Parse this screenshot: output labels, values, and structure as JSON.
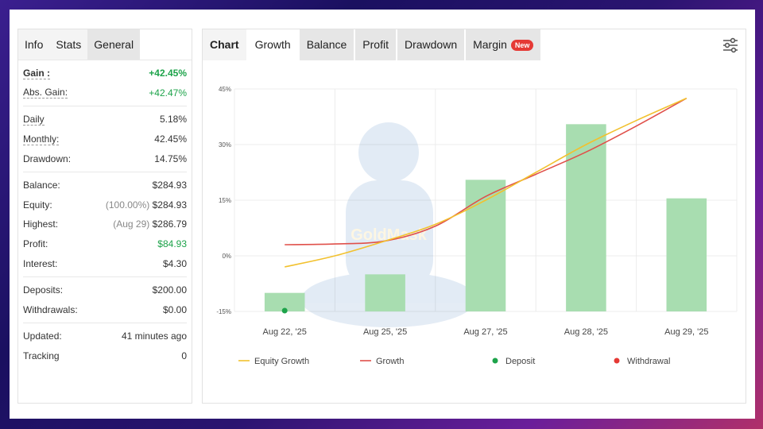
{
  "left_tabs": [
    "Info",
    "Stats",
    "General"
  ],
  "stats": {
    "gain": {
      "label": "Gain :",
      "value": "+42.45%"
    },
    "abs_gain": {
      "label": "Abs. Gain:",
      "value": "+42.47%"
    },
    "daily": {
      "label": "Daily",
      "value": "5.18%"
    },
    "monthly": {
      "label": "Monthly:",
      "value": "42.45%"
    },
    "drawdown": {
      "label": "Drawdown:",
      "value": "14.75%"
    },
    "balance": {
      "label": "Balance:",
      "value": "$284.93"
    },
    "equity": {
      "label": "Equity:",
      "sub": "(100.00%)",
      "value": "$284.93"
    },
    "highest": {
      "label": "Highest:",
      "sub": "(Aug 29)",
      "value": "$286.79"
    },
    "profit": {
      "label": "Profit:",
      "value": "$84.93"
    },
    "interest": {
      "label": "Interest:",
      "value": "$4.30"
    },
    "deposits": {
      "label": "Deposits:",
      "value": "$200.00"
    },
    "withdrawals": {
      "label": "Withdrawals:",
      "value": "$0.00"
    },
    "updated": {
      "label": "Updated:",
      "value": "41 minutes ago"
    },
    "tracking": {
      "label": "Tracking",
      "value": "0"
    }
  },
  "chart_tabs": {
    "label": "Chart",
    "items": [
      "Growth",
      "Balance",
      "Profit",
      "Drawdown",
      "Margin"
    ],
    "badge": "New"
  },
  "watermark": "GoldMask",
  "icons": {
    "settings": "sliders-icon"
  },
  "colors": {
    "bar": "#a8ddb0",
    "equity_line": "#f2c12e",
    "growth_line": "#e0504a",
    "deposit": "#1da34a",
    "withdrawal": "#e53935"
  },
  "chart_data": {
    "type": "bar",
    "categories": [
      "Aug 22, '25",
      "Aug 25, '25",
      "Aug 27, '25",
      "Aug 28, '25",
      "Aug 29, '25"
    ],
    "yticks": [
      "45%",
      "30%",
      "15%",
      "0%",
      "-15%"
    ],
    "ylim": [
      -15,
      45
    ],
    "bars": [
      -10,
      -5,
      20.5,
      35.5,
      15.5
    ],
    "series": [
      {
        "name": "Equity Growth",
        "x": [
          0,
          0.5,
          1,
          1.5,
          2,
          2.5,
          3,
          3.5,
          4
        ],
        "values": [
          -3,
          0,
          4,
          8.5,
          15,
          22.5,
          30,
          36.5,
          42.5
        ]
      },
      {
        "name": "Growth",
        "x": [
          0,
          0.5,
          1,
          1.5,
          2,
          2.5,
          3,
          3.5,
          4
        ],
        "values": [
          3,
          3.2,
          4,
          8,
          16,
          22,
          28,
          35,
          42.5
        ]
      }
    ],
    "deposit_points": [
      {
        "x": 0,
        "y": -15
      }
    ],
    "legend": [
      "Equity Growth",
      "Growth",
      "Deposit",
      "Withdrawal"
    ],
    "grid": true,
    "legend_position": "bottom"
  }
}
